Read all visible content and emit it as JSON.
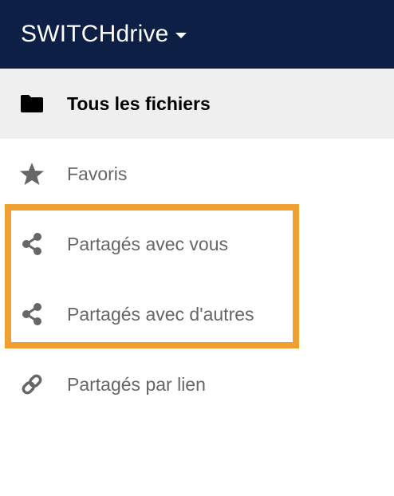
{
  "header": {
    "app_title": "SWITCHdrive",
    "background_color": "#0d1f45"
  },
  "nav": {
    "items": [
      {
        "label": "Tous les fichiers",
        "icon": "folder-icon",
        "active": true
      },
      {
        "label": "Favoris",
        "icon": "star-icon",
        "active": false
      },
      {
        "label": "Partagés avec vous",
        "icon": "share-icon",
        "active": false
      },
      {
        "label": "Partagés avec d'autres",
        "icon": "share-icon",
        "active": false
      },
      {
        "label": "Partagés par lien",
        "icon": "link-icon",
        "active": false
      }
    ]
  },
  "highlight": {
    "color": "#f0a030"
  }
}
